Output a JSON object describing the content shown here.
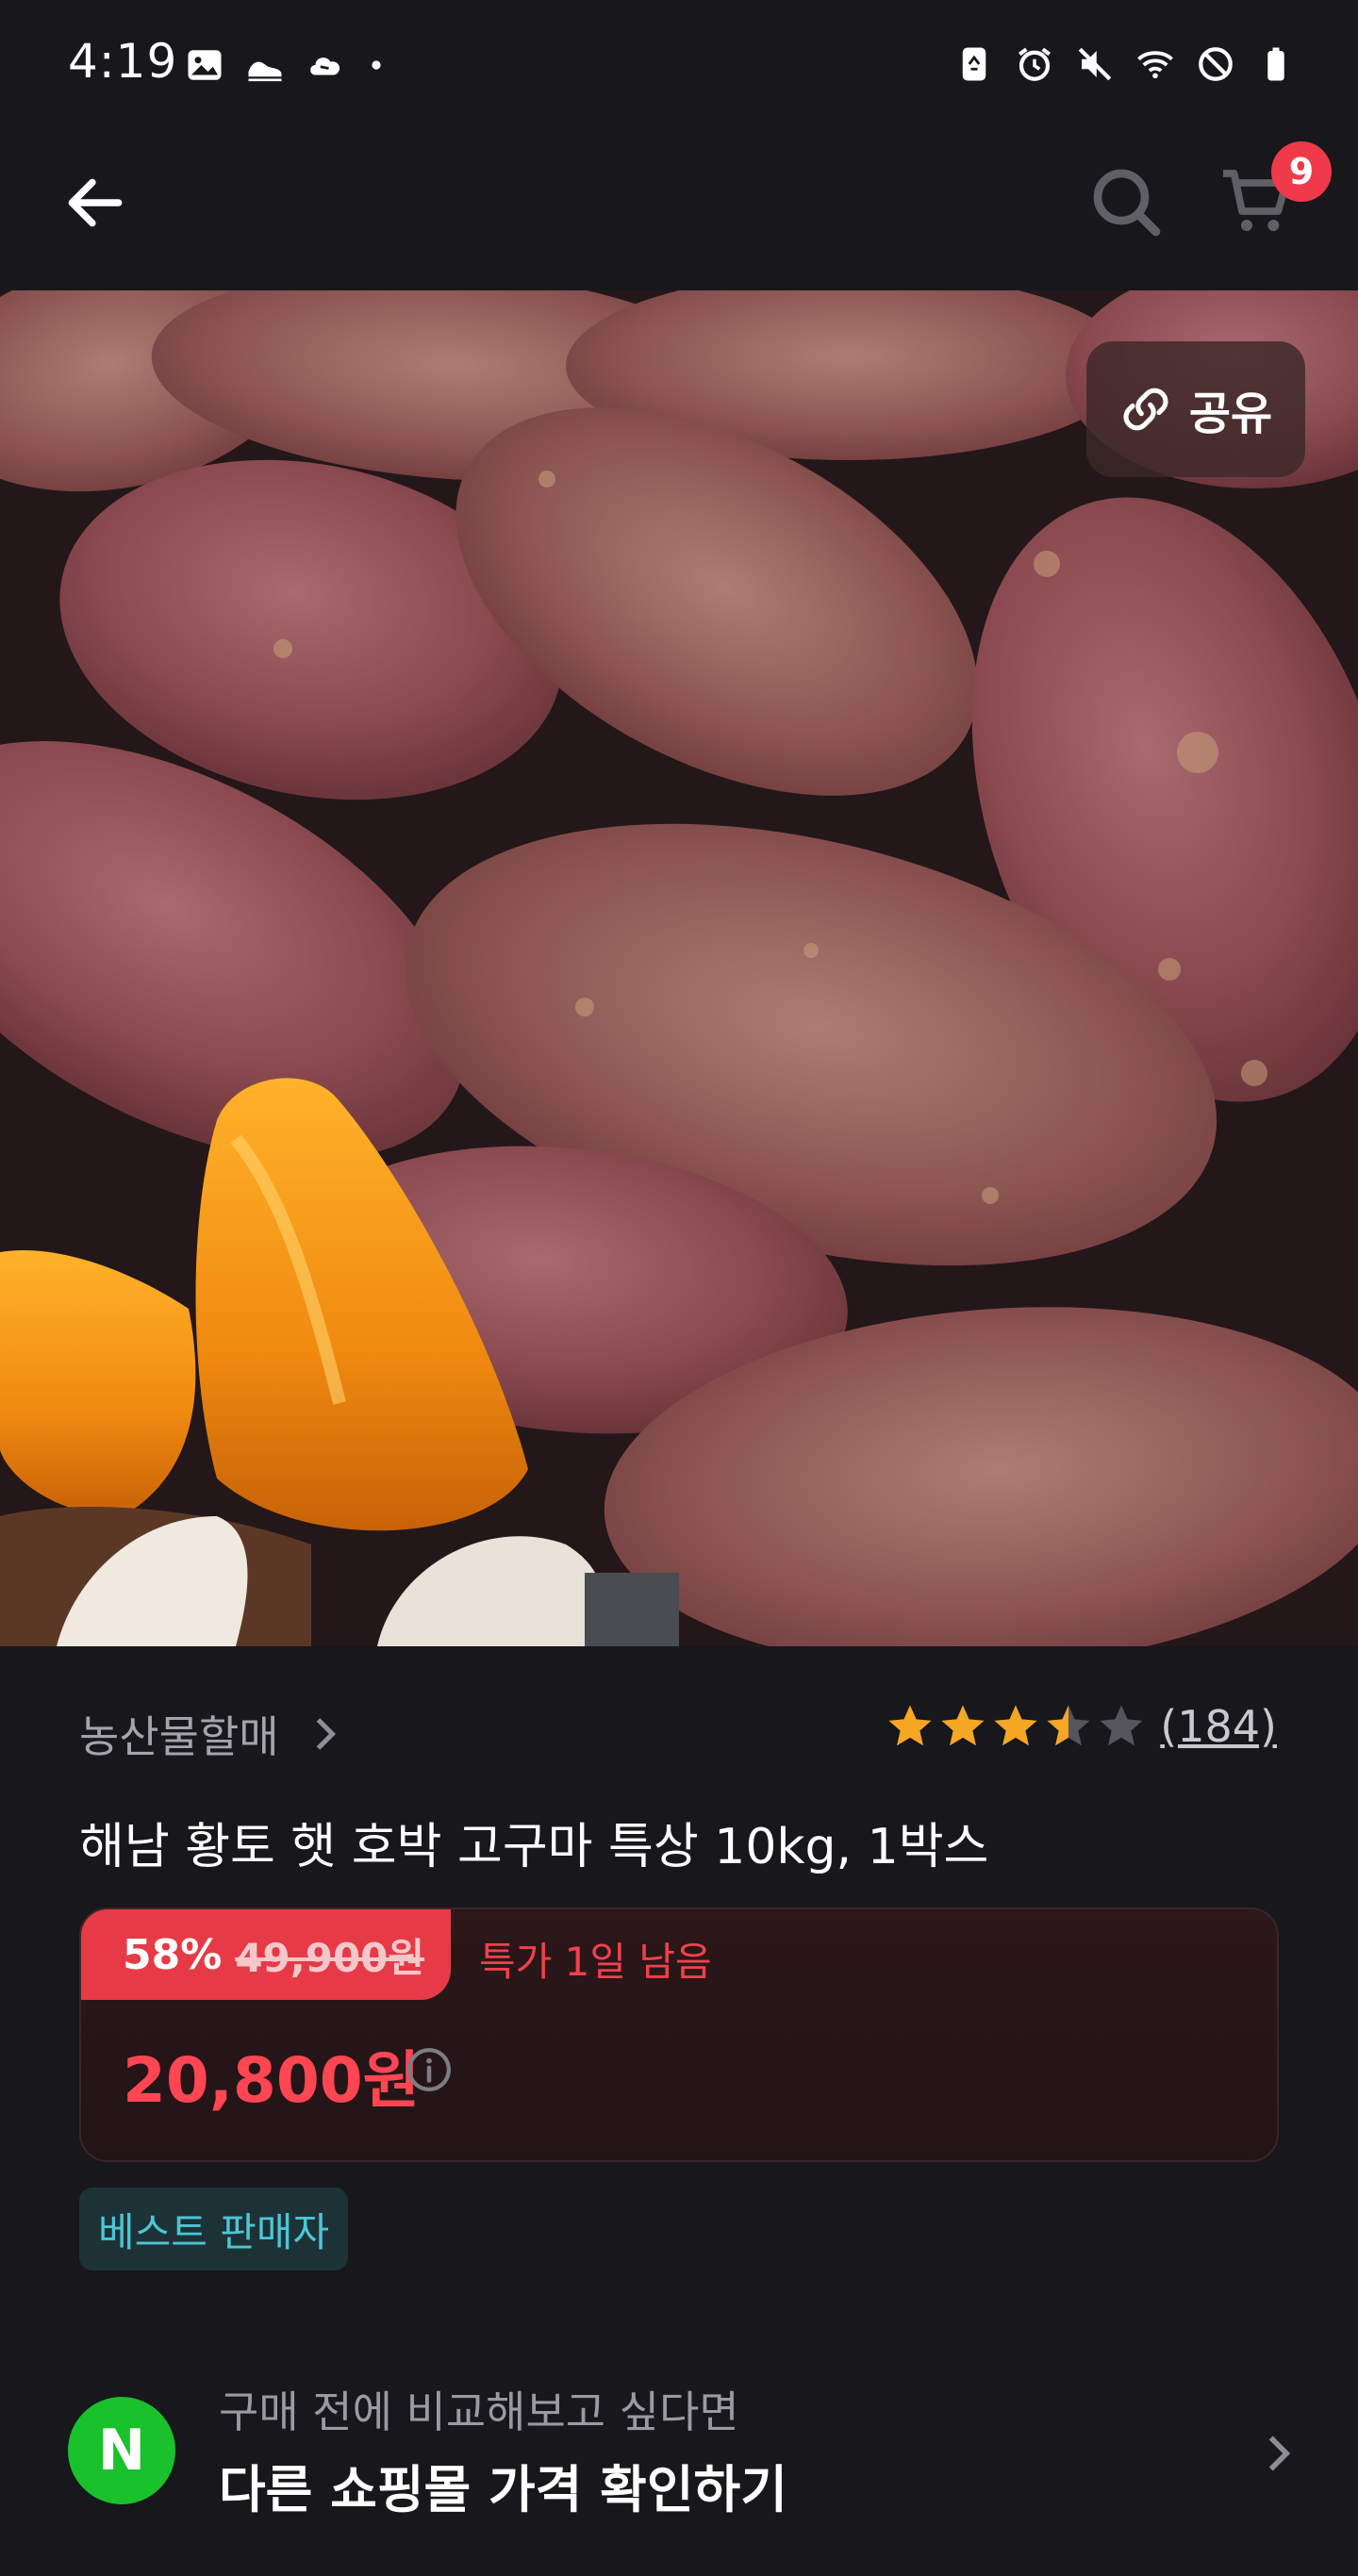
{
  "status_bar": {
    "time": "4:19",
    "left_icons": [
      "gallery-icon",
      "shoe-icon",
      "cloud-icon",
      "dot-icon"
    ],
    "right_icons": [
      "recycle-icon",
      "alarm-icon",
      "mute-icon",
      "wifi-icon",
      "no-disturb-icon",
      "battery-icon"
    ]
  },
  "nav": {
    "back_icon": "arrow-left-icon",
    "search_icon": "search-icon",
    "cart_icon": "cart-icon",
    "cart_count": "9"
  },
  "hero": {
    "share_label": "공유",
    "share_icon": "link-icon"
  },
  "product": {
    "seller": "농산물할매",
    "rating_value": 3.5,
    "rating_max": 5,
    "review_count": "(184)",
    "title": "해남 황토 햇 호박 고구마 특상 10kg, 1박스",
    "discount_rate": "58%",
    "original_price": "49,900원",
    "deal_remaining": "특가 1일 남음",
    "sale_price": "20,800원",
    "badge": "베스트 판매자"
  },
  "compare": {
    "logo_letter": "N",
    "subtitle": "구매 전에 비교해보고 싶다면",
    "title": "다른 쇼핑몰 가격 확인하기"
  },
  "colors": {
    "background": "#17171c",
    "accent_red": "#f03a4a",
    "star": "#f5a623",
    "badge_teal": "#4cc6d6",
    "naver_green": "#19c12c"
  }
}
